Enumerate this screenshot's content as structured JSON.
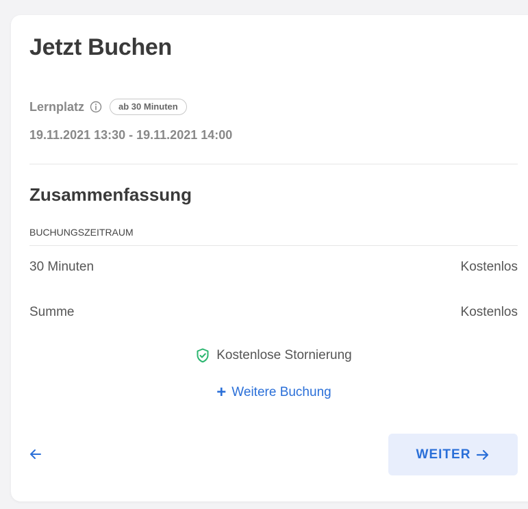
{
  "booking": {
    "title": "Jetzt Buchen",
    "place_label": "Lernplatz",
    "info_icon": "info-circle-icon",
    "duration_badge": "ab 30 Minuten",
    "date_range": "19.11.2021 13:30 - 19.11.2021 14:00"
  },
  "summary": {
    "title": "Zusammenfassung",
    "section_label": "BUCHUNGSZEITRAUM",
    "rows": [
      {
        "label": "30 Minuten",
        "value": "Kostenlos"
      },
      {
        "label": "Summe",
        "value": "Kostenlos"
      }
    ],
    "cancellation_icon": "shield-check-icon",
    "cancellation_text": "Kostenlose Stornierung",
    "add_booking_icon": "plus-icon",
    "add_booking_label": "Weitere Buchung"
  },
  "actions": {
    "back_icon": "arrow-left-icon",
    "next_label": "WEITER",
    "next_icon": "arrow-right-icon"
  },
  "colors": {
    "accent": "#2a6fd8",
    "button_bg": "#e8eefc",
    "shield": "#2bb56f",
    "muted_text": "#888888"
  }
}
